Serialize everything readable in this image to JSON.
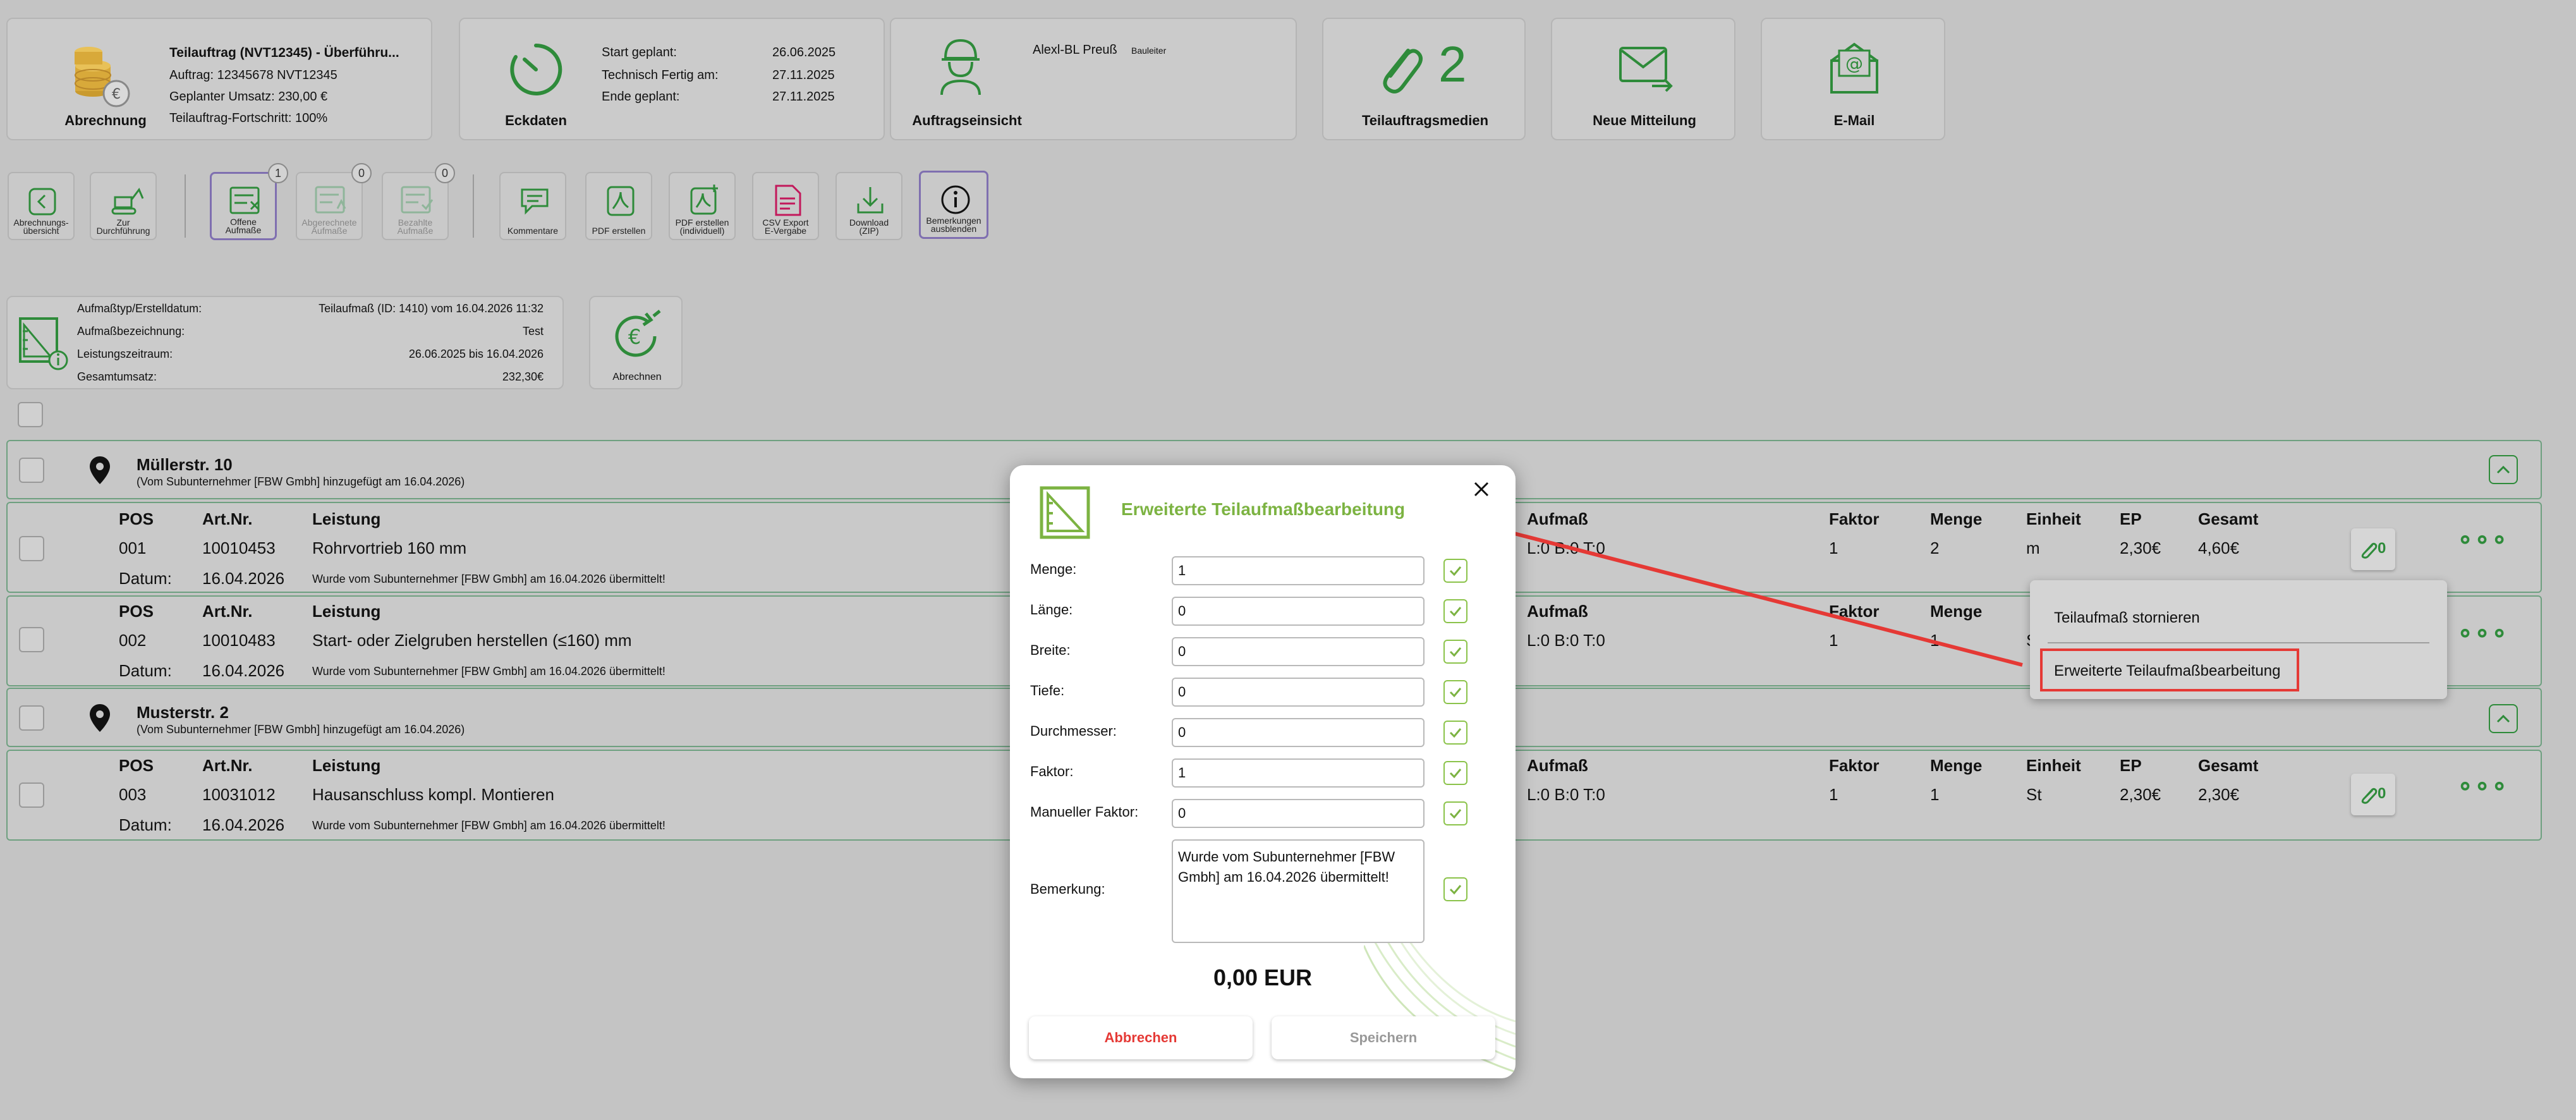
{
  "summary_cards": {
    "abrechnung": {
      "title": "Abrechnung",
      "heading": "Teilauftrag (NVT12345) - Überführu...",
      "lines": [
        "Auftrag: 12345678 NVT12345",
        "Geplanter Umsatz: 230,00 €",
        "Teilauftrag-Fortschritt: 100%"
      ]
    },
    "eckdaten": {
      "title": "Eckdaten",
      "rows": [
        {
          "label": "Start geplant:",
          "value": "26.06.2025"
        },
        {
          "label": "Technisch Fertig am:",
          "value": "27.11.2025"
        },
        {
          "label": "Ende geplant:",
          "value": "27.11.2025"
        }
      ]
    },
    "auftragseinsicht": {
      "title": "Auftragseinsicht",
      "person": "Alexl-BL Preuß",
      "role": "Bauleiter"
    },
    "teilauftragsmedien": {
      "title": "Teilauftragsmedien",
      "count": "2"
    },
    "neue_mitteilung": {
      "title": "Neue Mitteilung"
    },
    "email": {
      "title": "E-Mail"
    }
  },
  "toolbar": [
    {
      "label": "Abrechnungs-\nübersicht",
      "icon": "chevron-left-icon"
    },
    {
      "label": "Zur\nDurchführung",
      "icon": "excavator-icon"
    },
    {
      "label": "Offene\nAufmaße",
      "icon": "open-measure-icon",
      "badge": "1"
    },
    {
      "label": "Abgerechnete\nAufmaße",
      "icon": "billed-measure-icon",
      "badge": "0"
    },
    {
      "label": "Bezahlte\nAufmaße",
      "icon": "paid-measure-icon",
      "badge": "0"
    },
    {
      "label": "Kommentare",
      "icon": "comment-icon"
    },
    {
      "label": "PDF erstellen",
      "icon": "pdf-icon"
    },
    {
      "label": "PDF erstellen\n(individuell)",
      "icon": "pdf-custom-icon"
    },
    {
      "label": "CSV Export\nE-Vergabe",
      "icon": "csv-icon"
    },
    {
      "label": "Download\n(ZIP)",
      "icon": "download-icon"
    },
    {
      "label": "Bemerkungen\nausblenden",
      "icon": "info-icon"
    }
  ],
  "aufmass_info": {
    "rows": [
      {
        "label": "Aufmaßtyp/Erstelldatum:",
        "value": "Teilaufmaß (ID: 1410) vom 16.04.2026 11:32"
      },
      {
        "label": "Aufmaßbezeichnung:",
        "value": "Test"
      },
      {
        "label": "Leistungszeitraum:",
        "value": "26.06.2025 bis 16.04.2026"
      },
      {
        "label": "Gesamtumsatz:",
        "value": "232,30€"
      }
    ],
    "abrechnen_label": "Abrechnen"
  },
  "columns": {
    "pos": "POS",
    "artnr": "Art.Nr.",
    "leistung": "Leistung",
    "aufmass": "Aufmaß",
    "faktor": "Faktor",
    "menge": "Menge",
    "einheit": "Einheit",
    "ep": "EP",
    "gesamt": "Gesamt",
    "datum": "Datum:"
  },
  "groups": [
    {
      "address": "Müllerstr. 10",
      "sub": "(Vom Subunternehmer [FBW Gmbh] hinzugefügt am 16.04.2026)",
      "rows": [
        {
          "pos": "001",
          "artnr": "10010453",
          "leistung": "Rohrvortrieb 160 mm",
          "aufmass": "L:0 B:0 T:0",
          "faktor": "1",
          "menge": "2",
          "einheit": "m",
          "ep": "2,30€",
          "gesamt": "4,60€",
          "datum": "16.04.2026",
          "note": "Wurde vom Subunternehmer [FBW Gmbh] am 16.04.2026 übermittelt!",
          "attachments": "0"
        },
        {
          "pos": "002",
          "artnr": "10010483",
          "leistung": "Start- oder Zielgruben herstellen (≤160) mm",
          "aufmass": "L:0 B:0 T:0",
          "faktor": "1",
          "menge": "1",
          "einheit": "S",
          "ep": "",
          "gesamt": "",
          "datum": "16.04.2026",
          "note": "Wurde vom Subunternehmer [FBW Gmbh] am 16.04.2026 übermittelt!",
          "attachments": "0"
        }
      ]
    },
    {
      "address": "Musterstr. 2",
      "sub": "(Vom Subunternehmer [FBW Gmbh] hinzugefügt am 16.04.2026)",
      "rows": [
        {
          "pos": "003",
          "artnr": "10031012",
          "leistung": "Hausanschluss kompl. Montieren",
          "aufmass": "L:0 B:0 T:0",
          "faktor": "1",
          "menge": "1",
          "einheit": "St",
          "ep": "2,30€",
          "gesamt": "2,30€",
          "datum": "16.04.2026",
          "note": "Wurde vom Subunternehmer [FBW Gmbh] am 16.04.2026 übermittelt!",
          "attachments": "0"
        }
      ]
    }
  ],
  "context_menu": {
    "items": [
      "Teilaufmaß stornieren",
      "Erweiterte Teilaufmaßbearbeitung"
    ]
  },
  "modal": {
    "title": "Erweiterte Teilaufmaßbearbeitung",
    "fields": [
      {
        "label": "Menge:",
        "value": "1"
      },
      {
        "label": "Länge:",
        "value": "0"
      },
      {
        "label": "Breite:",
        "value": "0"
      },
      {
        "label": "Tiefe:",
        "value": "0"
      },
      {
        "label": "Durchmesser:",
        "value": "0"
      },
      {
        "label": "Faktor:",
        "value": "1"
      },
      {
        "label": "Manueller Faktor:",
        "value": "0"
      }
    ],
    "bemerkung_label": "Bemerkung:",
    "bemerkung_value": "Wurde vom Subunternehmer [FBW Gmbh] am 16.04.2026 übermittelt!",
    "total": "0,00 EUR",
    "cancel_label": "Abbrechen",
    "save_label": "Speichern"
  },
  "colors": {
    "brand_green": "#2e8b3a",
    "accent_green": "#7cb342",
    "cancel_red": "#e53935",
    "annotation_red": "#e53935"
  }
}
